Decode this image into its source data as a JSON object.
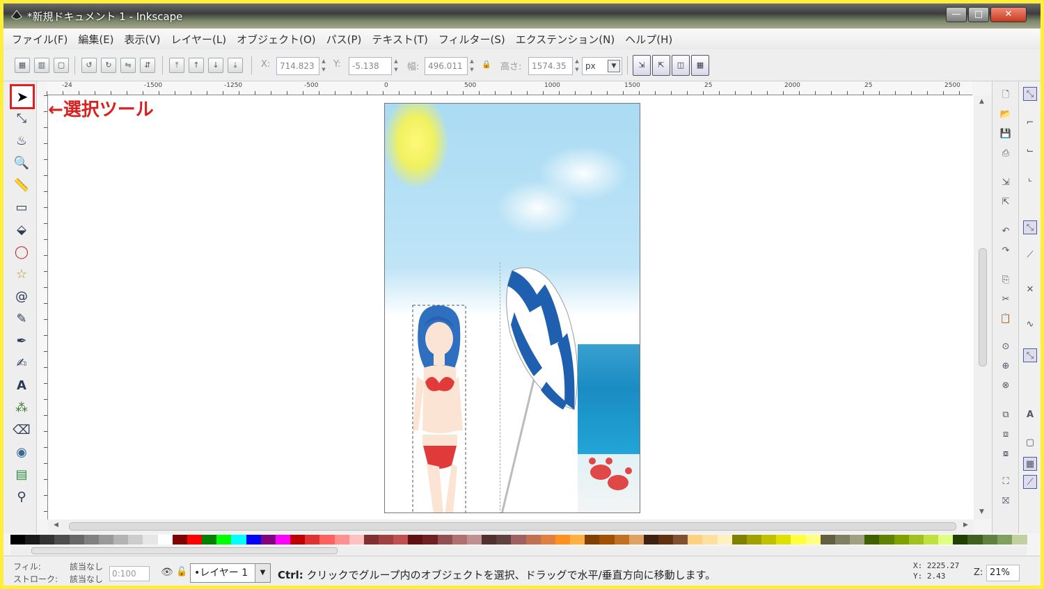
{
  "window": {
    "title": "*新規ドキュメント 1 - Inkscape",
    "minimize": "—",
    "maximize": "□",
    "close": "✕"
  },
  "menu": [
    "ファイル(F)",
    "編集(E)",
    "表示(V)",
    "レイヤー(L)",
    "オブジェクト(O)",
    "パス(P)",
    "テキスト(T)",
    "フィルター(S)",
    "エクステンション(N)",
    "ヘルプ(H)"
  ],
  "toolcontrols": {
    "x_label": "X:",
    "x_value": "714.823",
    "y_label": "Y:",
    "y_value": "-5.138",
    "w_label": "幅:",
    "w_value": "496.011",
    "h_label": "高さ:",
    "h_value": "1574.35",
    "unit": "px"
  },
  "ruler_labels": [
    "-24",
    "-1500",
    "-1250",
    "-500",
    "0",
    "500",
    "1000",
    "1500",
    "25",
    "2000",
    "25",
    "2500"
  ],
  "annotation": "←選択ツール",
  "icons": {
    "select": "select-arrow-icon",
    "node": "node-icon",
    "tweak": "tweak-icon",
    "zoom": "zoom-icon",
    "measure": "measure-icon",
    "rect": "rectangle-icon",
    "box3d": "3d-box-icon",
    "ellipse": "ellipse-icon",
    "star": "star-icon",
    "spiral": "spiral-icon",
    "pencil": "pencil-icon",
    "pen": "pen-icon",
    "calligraphy": "calligraphy-icon",
    "text": "text-icon",
    "spray": "spray-icon",
    "eraser": "eraser-icon",
    "bucket": "paint-bucket-icon",
    "gradient": "gradient-icon",
    "dropper": "dropper-icon"
  },
  "palette_colors": [
    "#000000",
    "#1a1a1a",
    "#333333",
    "#4d4d4d",
    "#666666",
    "#808080",
    "#999999",
    "#b3b3b3",
    "#cccccc",
    "#e6e6e6",
    "#ffffff",
    "#800000",
    "#ff0000",
    "#008000",
    "#00ff00",
    "#00ffff",
    "#0000ff",
    "#800080",
    "#ff00ff",
    "#c00000",
    "#e03030",
    "#ff6060",
    "#ff9090",
    "#ffc0c0",
    "#803030",
    "#a04040",
    "#c05050",
    "#601010",
    "#702020",
    "#905050",
    "#b07070",
    "#c09090",
    "#503030",
    "#604040",
    "#a06060",
    "#c07050",
    "#e08040",
    "#ff9020",
    "#ffb040",
    "#804000",
    "#a05000",
    "#c07020",
    "#e0a060",
    "#402010",
    "#603010",
    "#805030",
    "#ffd080",
    "#ffe0a0",
    "#fff0c0",
    "#808000",
    "#a0a000",
    "#c0c000",
    "#e0e000",
    "#ffff40",
    "#ffff80",
    "#606040",
    "#808060",
    "#a0a080",
    "#406000",
    "#608000",
    "#80a000",
    "#a0c020",
    "#c0e040",
    "#e0ff80",
    "#204000",
    "#406020",
    "#608040",
    "#80a060",
    "#c0d0a0"
  ],
  "status": {
    "fill_label": "フィル:",
    "fill_value": "該当なし",
    "stroke_label": "ストローク:",
    "stroke_value": "該当なし",
    "opacity": "0:100",
    "layer": "•レイヤー 1",
    "message_key": "Ctrl:",
    "message": " クリックでグループ内のオブジェクトを選択、ドラッグで水平/垂直方向に移動します。",
    "coord_x": "X: 2225.27",
    "coord_y": "Y:    2.43",
    "zoom_label": "Z:",
    "zoom": "21%"
  }
}
